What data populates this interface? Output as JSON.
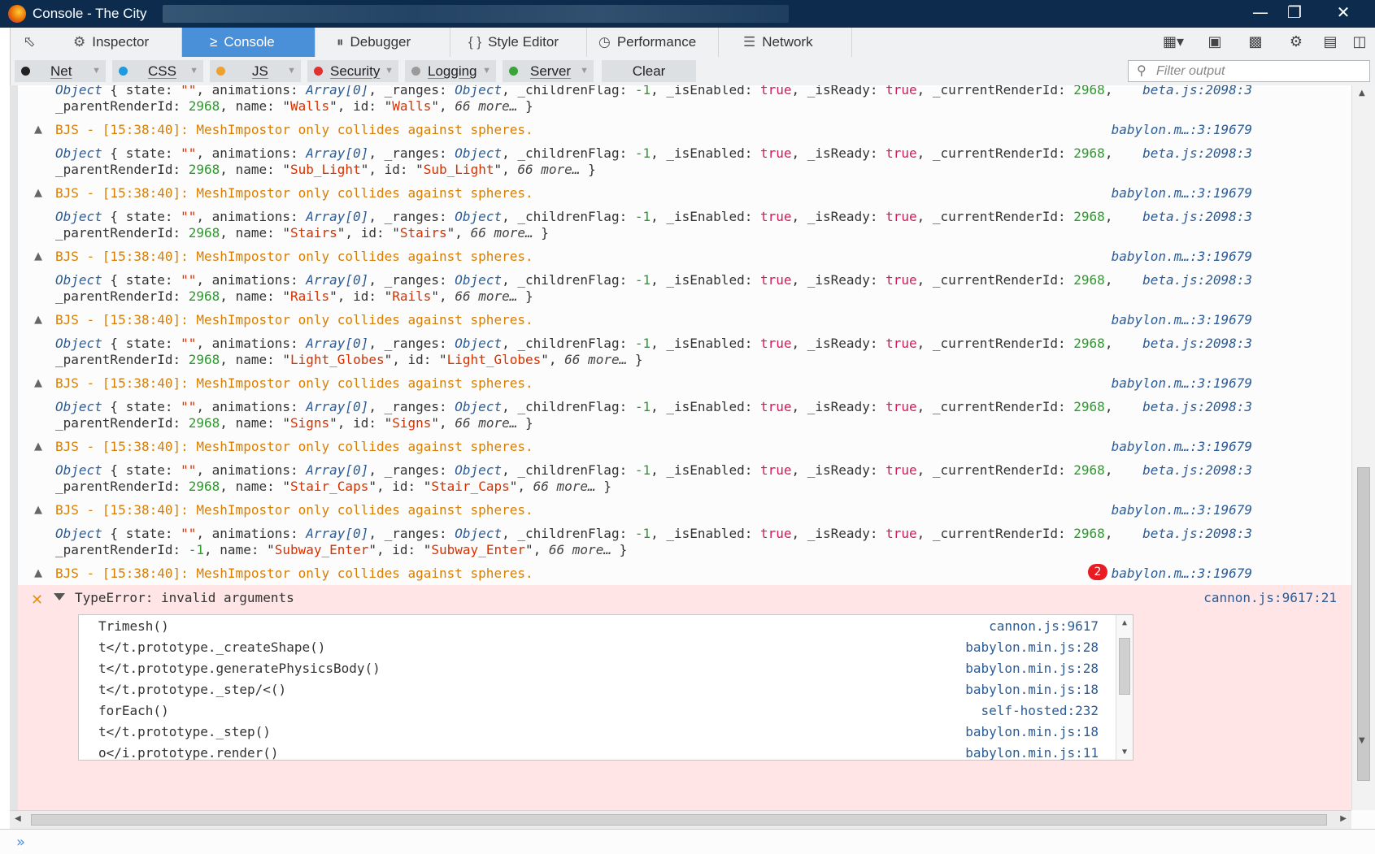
{
  "window": {
    "title": "Console - The City"
  },
  "tabs": [
    {
      "label": "Inspector",
      "icon": "gear-icon"
    },
    {
      "label": "Console",
      "icon": "terminal-icon"
    },
    {
      "label": "Debugger",
      "icon": "pause-icon"
    },
    {
      "label": "Style Editor",
      "icon": "braces-icon"
    },
    {
      "label": "Performance",
      "icon": "gauge-icon"
    },
    {
      "label": "Network",
      "icon": "list-icon"
    }
  ],
  "filters": [
    {
      "label": "Net",
      "color": "#222222"
    },
    {
      "label": "CSS",
      "color": "#1e9be0"
    },
    {
      "label": "JS",
      "color": "#f0a030"
    },
    {
      "label": "Security",
      "color": "#e03030"
    },
    {
      "label": "Logging",
      "color": "#9a9a9a"
    },
    {
      "label": "Server",
      "color": "#3aa33a"
    }
  ],
  "clear_label": "Clear",
  "filter_placeholder": "Filter output",
  "warning": {
    "text": "BJS - [15:38:40]: MeshImpostor only collides against spheres.",
    "source": "babylon.m…:3:19679"
  },
  "object_source": "beta.js:2098:3",
  "objects": [
    {
      "renderId": "2968",
      "parentRenderId": "2968",
      "name": "Walls",
      "id": "Walls"
    },
    {
      "renderId": "2968",
      "parentRenderId": "2968",
      "name": "Sub_Light",
      "id": "Sub_Light"
    },
    {
      "renderId": "2968",
      "parentRenderId": "2968",
      "name": "Stairs",
      "id": "Stairs"
    },
    {
      "renderId": "2968",
      "parentRenderId": "2968",
      "name": "Rails",
      "id": "Rails"
    },
    {
      "renderId": "2968",
      "parentRenderId": "2968",
      "name": "Light_Globes",
      "id": "Light_Globes"
    },
    {
      "renderId": "2968",
      "parentRenderId": "2968",
      "name": "Signs",
      "id": "Signs"
    },
    {
      "renderId": "2968",
      "parentRenderId": "2968",
      "name": "Stair_Caps",
      "id": "Stair_Caps"
    },
    {
      "renderId": "2968",
      "parentRenderId": "-1",
      "name": "Subway_Enter",
      "id": "Subway_Enter"
    }
  ],
  "object_fields": {
    "prefix": "Object",
    "state": "\"\"",
    "animations": "Array[0]",
    "ranges": "Object",
    "childrenFlag": "-1",
    "isEnabled": "true",
    "isReady": "true",
    "more": "66 more…"
  },
  "last_warning_badge": "2",
  "error": {
    "message": "TypeError: invalid arguments",
    "source": "cannon.js:9617:21",
    "stack": [
      {
        "fn": "Trimesh()",
        "src": "cannon.js:9617"
      },
      {
        "fn": "t</t.prototype._createShape()",
        "src": "babylon.min.js:28"
      },
      {
        "fn": "t</t.prototype.generatePhysicsBody()",
        "src": "babylon.min.js:28"
      },
      {
        "fn": "t</t.prototype._step/<()",
        "src": "babylon.min.js:18"
      },
      {
        "fn": "forEach()",
        "src": "self-hosted:232"
      },
      {
        "fn": "t</t.prototype._step()",
        "src": "babylon.min.js:18"
      },
      {
        "fn": "o</i.prototype.render()",
        "src": "babylon.min.js:11"
      }
    ]
  }
}
